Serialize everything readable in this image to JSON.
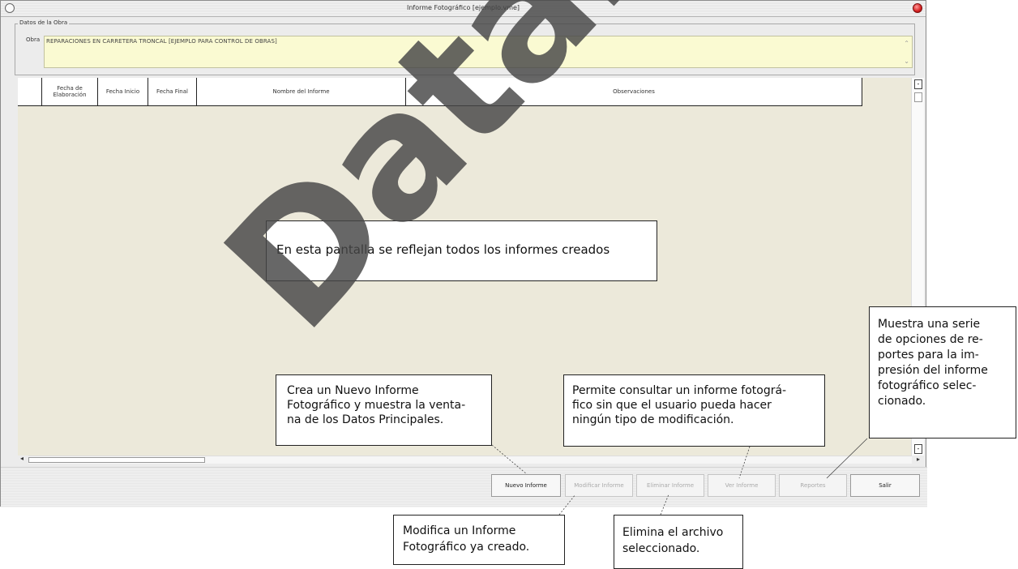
{
  "window": {
    "title": "Informe Fotográfico [ejemplo.vme]"
  },
  "group": {
    "legend": "Datos de la Obra",
    "obra_label": "Obra",
    "obra_value": "REPARACIONES EN CARRETERA TRONCAL [EJEMPLO PARA CONTROL DE OBRAS]"
  },
  "table": {
    "columns": [
      "",
      "Fecha de Elaboración",
      "Fecha Inicio",
      "Fecha Final",
      "Nombre del Informe",
      "Observaciones"
    ]
  },
  "buttons": {
    "nuevo": "Nuevo Informe",
    "modificar": "Modificar Informe",
    "eliminar": "Eliminar Informe",
    "ver": "Ver Informe",
    "reportes": "Reportes",
    "salir": "Salir"
  },
  "callouts": {
    "main": "En esta pantalla se reflejan todos los informes creados",
    "nuevo": [
      "Crea un Nuevo Informe",
      "Fotográfico y muestra la venta-",
      "na de los Datos Principales."
    ],
    "ver": [
      "Permite consultar un informe fotográ-",
      "fico sin que el usuario pueda hacer",
      "ningún tipo de modificación."
    ],
    "reportes": [
      "Muestra una serie",
      "de opciones de re-",
      "portes para la im-",
      "presión del informe",
      "fotográfico selec-",
      "cionado."
    ],
    "modificar": [
      "Modifica un Informe",
      "Fotográfico ya creado."
    ],
    "eliminar": [
      "Elimina el archivo",
      "seleccionado."
    ]
  },
  "watermark": "DataLa",
  "icons": {
    "window_control": "window-circle-icon",
    "close": "close-icon"
  },
  "colors": {
    "obra_bg": "#fafad2",
    "grid_bg": "#ece9da",
    "close": "#d62020"
  }
}
